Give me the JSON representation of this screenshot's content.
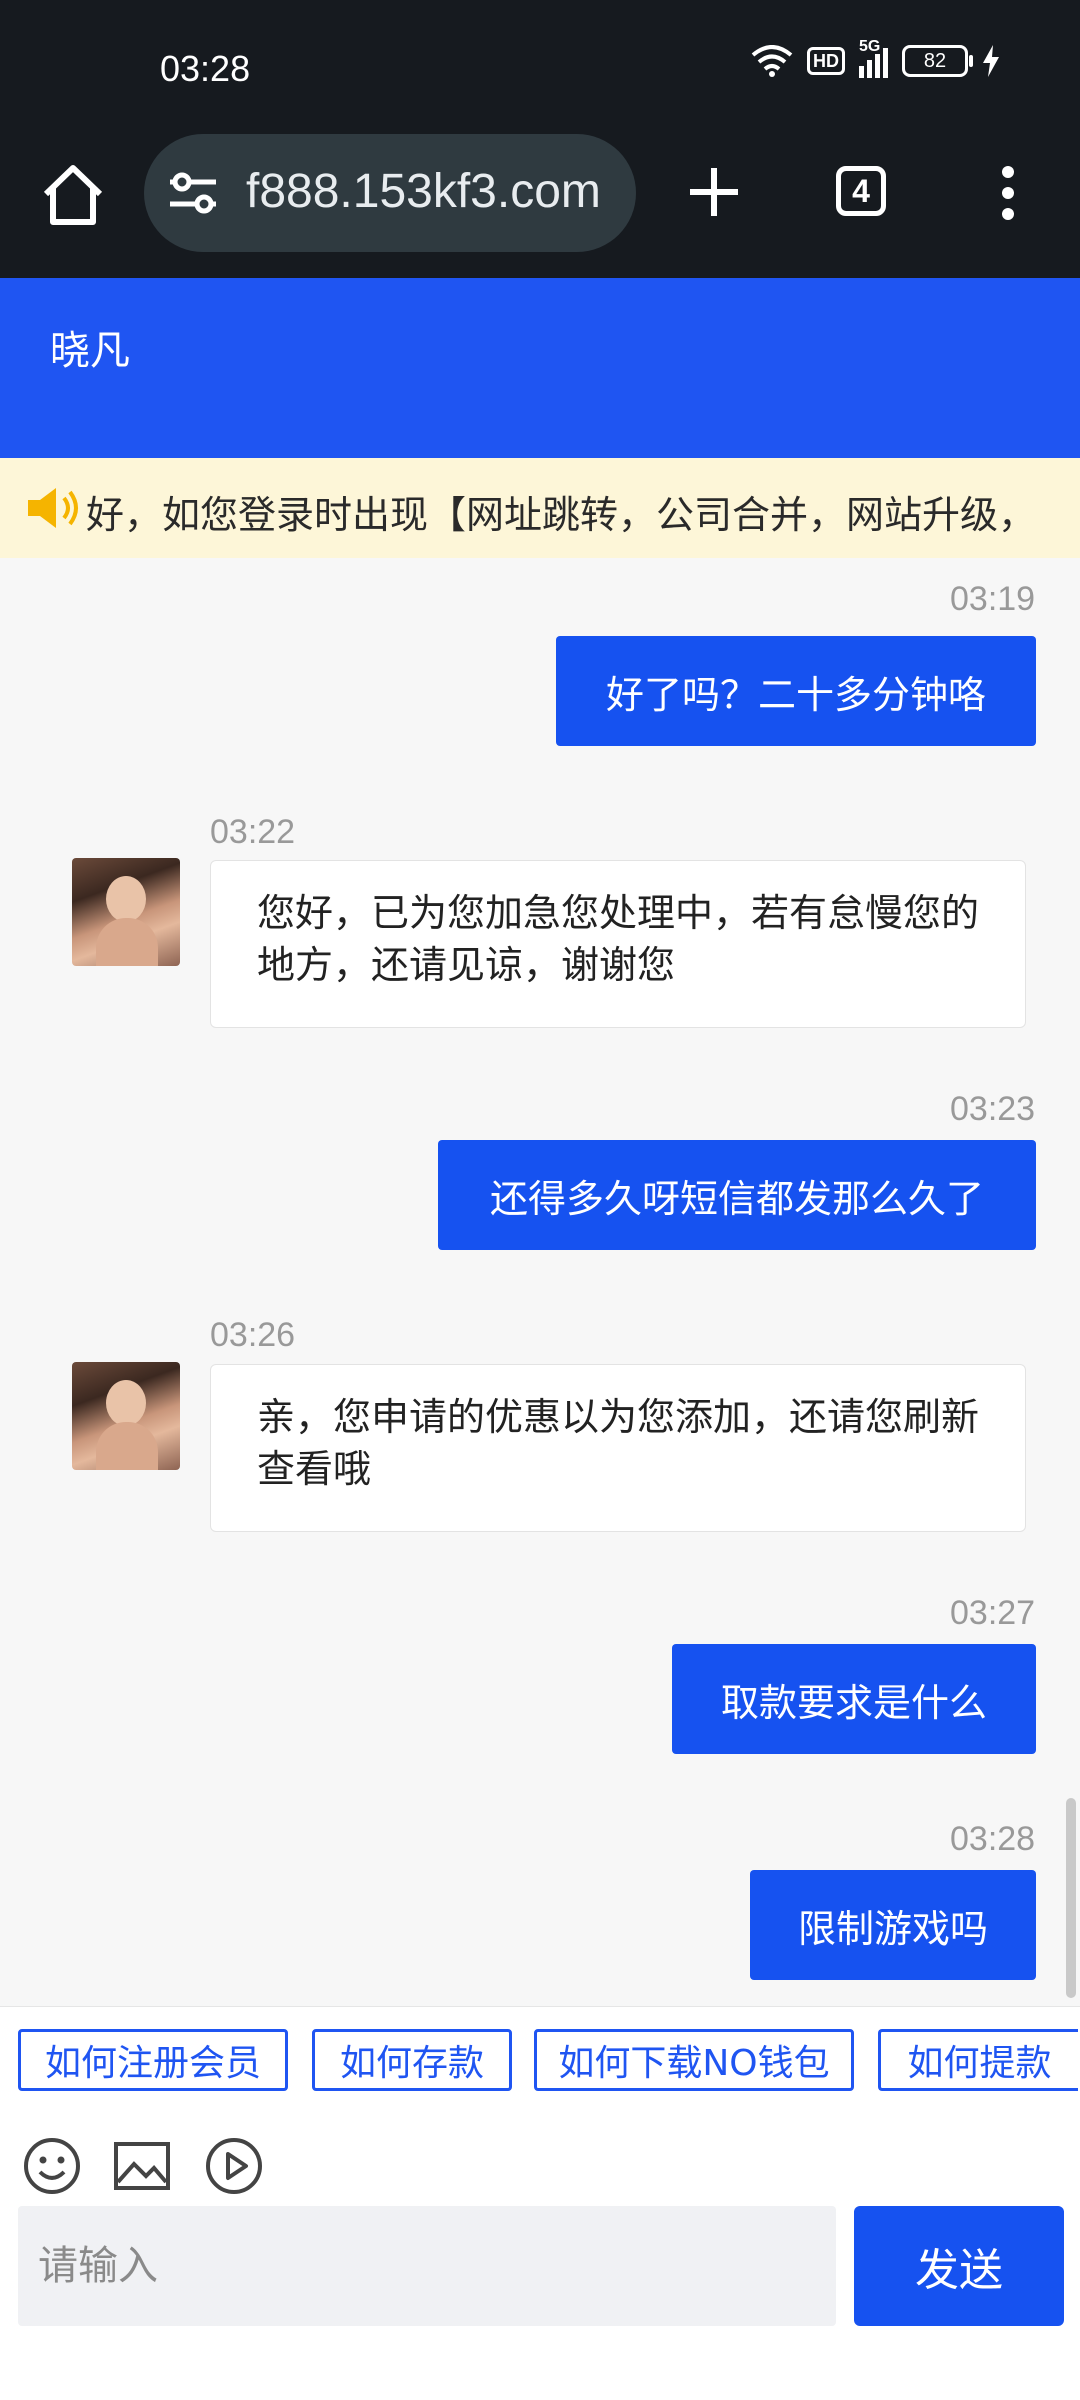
{
  "status_bar": {
    "time": "03:28",
    "network": "5G",
    "hd": "HD",
    "battery": "82"
  },
  "browser": {
    "url": "f888.153kf3.com",
    "tab_count": "4"
  },
  "chat": {
    "agent_name": "晓凡",
    "notice": "好，如您登录时出现【网址跳转，公司合并，网站升级，",
    "messages": [
      {
        "time": "03:19",
        "direction": "out",
        "text": "好了吗？二十多分钟咯"
      },
      {
        "time": "03:22",
        "direction": "in",
        "text": "您好，已为您加急您处理中，若有怠慢您的地方，还请见谅，谢谢您"
      },
      {
        "time": "03:23",
        "direction": "out",
        "text": "还得多久呀短信都发那么久了"
      },
      {
        "time": "03:26",
        "direction": "in",
        "text": "亲，您申请的优惠以为您添加，还请您刷新查看哦"
      },
      {
        "time": "03:27",
        "direction": "out",
        "text": "取款要求是什么"
      },
      {
        "time": "03:28",
        "direction": "out",
        "text": "限制游戏吗"
      }
    ],
    "quick_replies": [
      "如何注册会员",
      "如何存款",
      "如何下载NO钱包",
      "如何提款"
    ],
    "input_placeholder": "请输入",
    "send_label": "发送"
  },
  "colors": {
    "primary": "#1f55f2",
    "notice_bg": "#fdf6d8",
    "browser_bg": "#161a1f"
  },
  "icons": [
    "home-icon",
    "site-settings-icon",
    "plus-icon",
    "tabs-icon",
    "more-vert-icon",
    "speaker-icon",
    "emoji-icon",
    "image-icon",
    "play-icon"
  ]
}
